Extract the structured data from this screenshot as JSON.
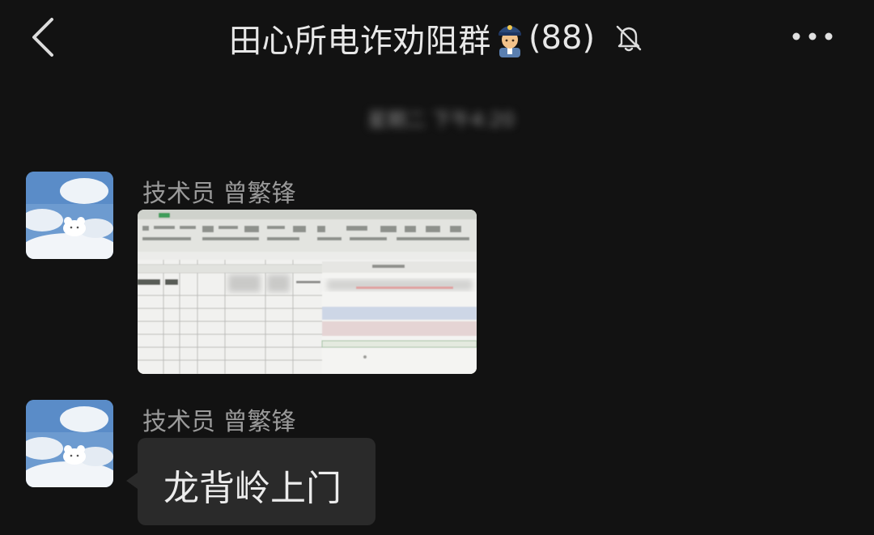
{
  "header": {
    "back_icon": "chevron-left-icon",
    "title": "田心所电诈劝阻群",
    "title_emoji": "police-officer-icon",
    "member_count": "(88)",
    "mute_icon": "bell-off-icon",
    "more_icon": "more-dots-icon"
  },
  "timestamp": "星期二 下午4:20",
  "messages": [
    {
      "sender": "技术员 曾繁锋",
      "type": "image",
      "avatar_icon": "sky-cloud-bear-avatar"
    },
    {
      "sender": "技术员 曾繁锋",
      "type": "text",
      "text": "龙背岭上门",
      "avatar_icon": "sky-cloud-bear-avatar"
    }
  ],
  "colors": {
    "background": "#121212",
    "bubble": "#2a2a2a",
    "title": "#e8e8e8",
    "sender": "#9a9a9a"
  }
}
